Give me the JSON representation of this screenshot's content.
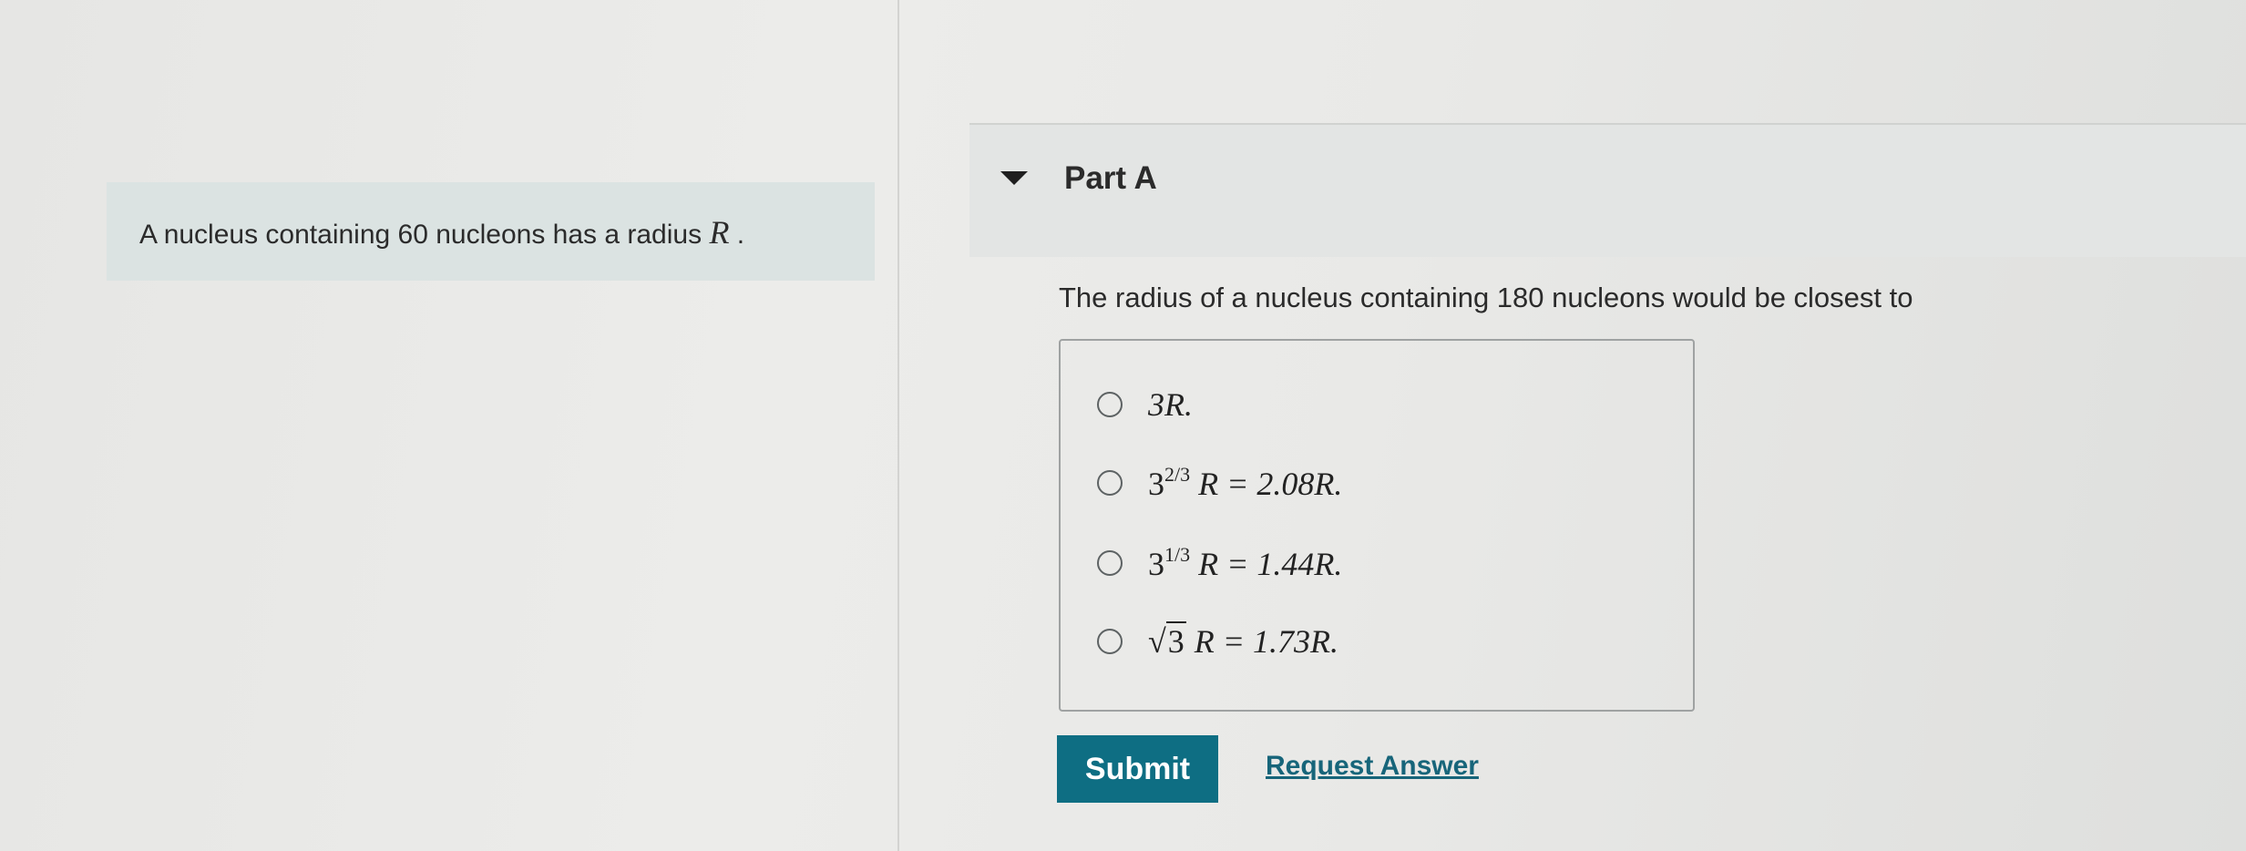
{
  "intro": {
    "text": "A nucleus containing 60 nucleons has a radius",
    "symbol": "R",
    "trailing": "."
  },
  "part": {
    "title": "Part A",
    "question": "The radius of a nucleus containing 180 nucleons would be closest to"
  },
  "choices": [
    {
      "label": "3R."
    },
    {
      "base": "3",
      "exponent": "2/3",
      "rest": " R = 2.08R."
    },
    {
      "base": "3",
      "exponent": "1/3",
      "rest": " R = 1.44R."
    },
    {
      "radicand": "3",
      "rest": " R = 1.73R."
    }
  ],
  "actions": {
    "submit_label": "Submit",
    "request_answer_label": "Request Answer"
  },
  "colors": {
    "submit_bg": "#0e6e83",
    "link": "#17657a",
    "intro_bg": "#dbe3e2"
  }
}
